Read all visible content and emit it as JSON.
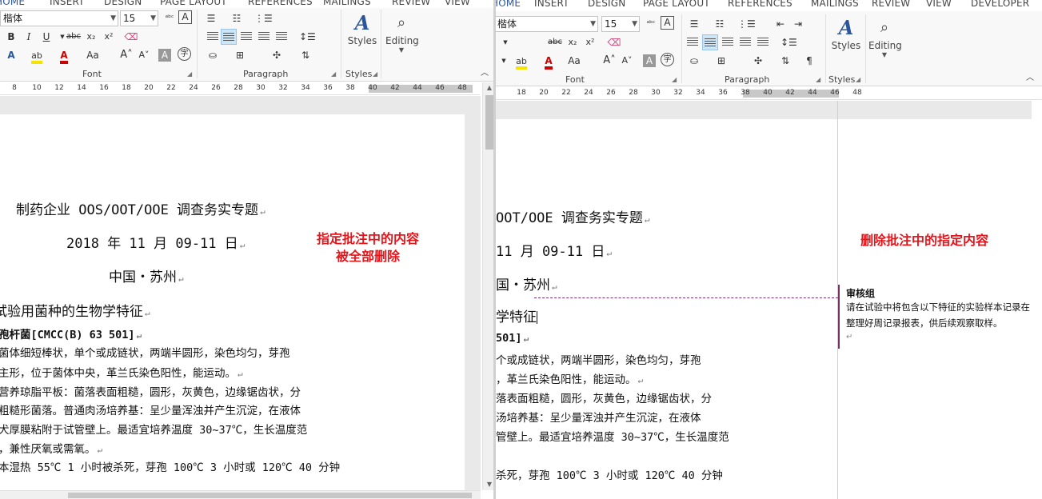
{
  "left": {
    "tabs": [
      "HOME",
      "INSERT",
      "DESIGN",
      "PAGE LAYOUT",
      "REFERENCES",
      "MAILINGS",
      "REVIEW",
      "VIEW"
    ],
    "font_name": "楷体",
    "font_size": "15",
    "group_labels": {
      "font": "Font",
      "paragraph": "Paragraph",
      "styles": "Styles"
    },
    "styles_label": "Styles",
    "editing_label": "Editing",
    "ruler_ticks": [
      "8",
      "10",
      "12",
      "14",
      "16",
      "18",
      "20",
      "22",
      "24",
      "26",
      "28",
      "30",
      "32",
      "34",
      "36",
      "38",
      "40",
      "42",
      "44",
      "46",
      "48"
    ],
    "doc_lines": [
      "制药企业 OOS/OOT/OOE 调查务实专题",
      "2018 年 11 月 09-11 日",
      "中国・苏州",
      "试验用菌种的生物学特征",
      "孢杆菌[CMCC(B) 63 501]",
      "  菌体细短棒状，单个或成链状，两端半圆形，染色均匀，芽孢",
      "主形，位于菌体中央，革兰氏染色阳性，能运动。",
      "营养琼脂平板：菌落表面粗糙，圆形，灰黄色，边缘锯齿状，分",
      "粗糙形菌落。普通肉汤培养基：呈少量浑浊并产生沉淀，在液体",
      "犬厚膜粘附于试管壁上。最适宜培养温度 30~37℃，生长温度范",
      "，兼性厌氧或需氧。",
      "本湿热 55℃ 1 小时被杀死，芽孢 100℃ 3 小时或 120℃ 40 分钟"
    ],
    "annotation": [
      "指定批注中的内容",
      "被全部删除"
    ]
  },
  "right": {
    "tabs": [
      "HOME",
      "INSERT",
      "DESIGN",
      "PAGE LAYOUT",
      "REFERENCES",
      "MAILINGS",
      "REVIEW",
      "VIEW",
      "DEVELOPER"
    ],
    "font_name": "楷体",
    "font_size": "15",
    "group_labels": {
      "font": "Font",
      "paragraph": "Paragraph",
      "styles": "Styles"
    },
    "styles_label": "Styles",
    "editing_label": "Editing",
    "ruler_ticks": [
      "18",
      "20",
      "22",
      "24",
      "26",
      "28",
      "30",
      "32",
      "34",
      "36",
      "38",
      "40",
      "42",
      "44",
      "46",
      "48"
    ],
    "doc_lines": [
      "OOT/OOE 调查务实专题",
      "11 月 09-11 日",
      "国・苏州",
      "学特征",
      "501]",
      "个或成链状，两端半圆形，染色均匀，芽孢",
      "，革兰氏染色阳性，能运动。",
      "落表面粗糙，圆形，灰黄色，边缘锯齿状，分",
      "汤培养基：呈少量浑浊并产生沉淀，在液体",
      "管壁上。最适宜培养温度 30~37℃，生长温度范",
      "",
      "杀死，芽孢 100℃ 3 小时或 120℃ 40 分钟"
    ],
    "annotation": "删除批注中的指定内容",
    "comment": {
      "author": "审核组",
      "text": "请在试验中将包含以下特征的实验样本记录在整理好周记录报表，供后续观察取样。"
    }
  }
}
